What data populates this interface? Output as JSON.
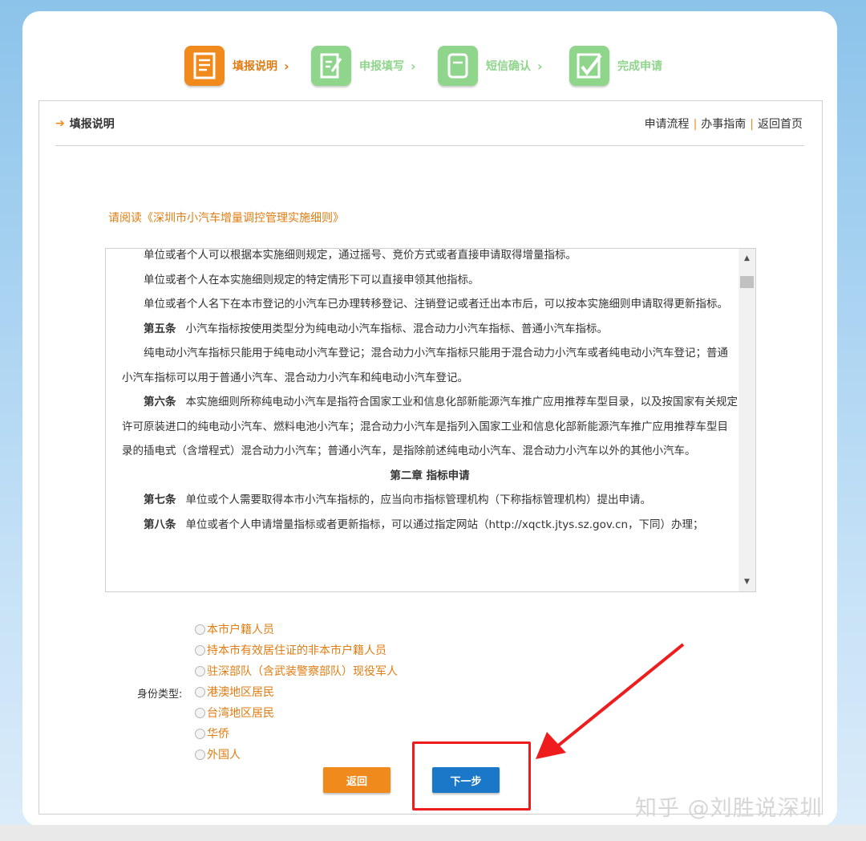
{
  "steps": [
    {
      "label": "填报说明",
      "state": "active"
    },
    {
      "label": "申报填写",
      "state": "inactive"
    },
    {
      "label": "短信确认",
      "state": "inactive"
    },
    {
      "label": "完成申请",
      "state": "inactive"
    }
  ],
  "panel": {
    "title": "填报说明",
    "nav": {
      "process": "申请流程",
      "guide": "办事指南",
      "home": "返回首页"
    }
  },
  "notice": "请阅读《深圳市小汽车增量调控管理实施细则》",
  "regulation": {
    "p1": "单位或者个人可以根据本实施细则规定，通过摇号、竞价方式或者直接申请取得增量指标。",
    "p2": "单位或者个人在本实施细则规定的特定情形下可以直接申领其他指标。",
    "p3": "单位或者个人名下在本市登记的小汽车已办理转移登记、注销登记或者迁出本市后，可以按本实施细则申请取得更新指标。",
    "a5_title": "第五条",
    "a5": "小汽车指标按使用类型分为纯电动小汽车指标、混合动力小汽车指标、普通小汽车指标。",
    "p5b": "纯电动小汽车指标只能用于纯电动小汽车登记；混合动力小汽车指标只能用于混合动力小汽车或者纯电动小汽车登记；普通小汽车指标可以用于普通小汽车、混合动力小汽车和纯电动小汽车登记。",
    "a6_title": "第六条",
    "a6": "本实施细则所称纯电动小汽车是指符合国家工业和信息化部新能源汽车推广应用推荐车型目录，以及按国家有关规定许可原装进口的纯电动小汽车、燃料电池小汽车；混合动力小汽车是指列入国家工业和信息化部新能源汽车推广应用推荐车型目录的插电式（含增程式）混合动力小汽车；普通小汽车，是指除前述纯电动小汽车、混合动力小汽车以外的其他小汽车。",
    "chapter2": "第二章 指标申请",
    "a7_title": "第七条",
    "a7": "单位或个人需要取得本市小汽车指标的，应当向市指标管理机构（下称指标管理机构）提出申请。",
    "a8_title": "第八条",
    "a8": "单位或者个人申请增量指标或者更新指标，可以通过指定网站（http://xqctk.jtys.sz.gov.cn，下同）办理；"
  },
  "id_type": {
    "label": "身份类型:",
    "options": [
      "本市户籍人员",
      "持本市有效居住证的非本市户籍人员",
      "驻深部队（含武装警察部队）现役军人",
      "港澳地区居民",
      "台湾地区居民",
      "华侨",
      "外国人"
    ]
  },
  "buttons": {
    "back": "返回",
    "next": "下一步"
  },
  "watermark": "知乎 @刘胜说深圳",
  "colors": {
    "accent_orange": "#f08a1c",
    "step_inactive_green": "#8fd58c",
    "next_blue": "#1b78c8",
    "annotation_red": "#ee1c1c"
  }
}
